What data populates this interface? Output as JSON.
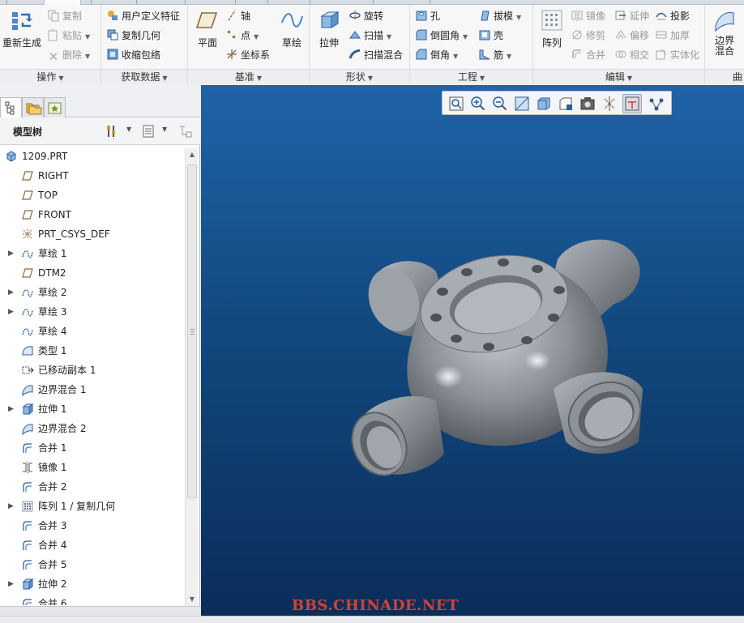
{
  "ribbon": {
    "groups": {
      "operations": "操作",
      "get_data": "获取数据",
      "datum": "基准",
      "shapes": "形状",
      "engineering": "工程",
      "editing": "编辑"
    },
    "operations": {
      "regenerate": "重新生成",
      "copy": "复制",
      "paste": "粘贴",
      "delete": "删除"
    },
    "get_data": {
      "user_defined_feature": "用户定义特征",
      "copy_geometry": "复制几何",
      "shrinkwrap": "收缩包络"
    },
    "datum": {
      "plane": "平面",
      "axis": "轴",
      "point": "点",
      "csys": "坐标系",
      "sketch": "草绘"
    },
    "shapes": {
      "extrude": "拉伸",
      "revolve": "旋转",
      "sweep": "扫描",
      "swept_blend": "扫描混合"
    },
    "engineering": {
      "hole": "孔",
      "round": "倒圆角",
      "chamfer": "倒角",
      "draft": "拔模",
      "shell": "壳",
      "rib": "筋"
    },
    "editing": {
      "pattern": "阵列",
      "mirror": "镜像",
      "trim": "修剪",
      "merge": "合并",
      "extend": "延伸",
      "offset": "偏移",
      "intersect": "相交",
      "project": "投影",
      "thicken": "加厚",
      "solidify": "实体化"
    },
    "surfaces": {
      "boundary_blend_line1": "边界",
      "boundary_blend_line2": "混合",
      "cut_label": "曲"
    }
  },
  "model_tree": {
    "title": "模型树",
    "items": [
      {
        "label": "1209.PRT",
        "icon": "part-icon",
        "expandable": false
      },
      {
        "label": "RIGHT",
        "icon": "datum-plane-icon",
        "expandable": false
      },
      {
        "label": "TOP",
        "icon": "datum-plane-icon",
        "expandable": false
      },
      {
        "label": "FRONT",
        "icon": "datum-plane-icon",
        "expandable": false
      },
      {
        "label": "PRT_CSYS_DEF",
        "icon": "csys-icon",
        "expandable": false
      },
      {
        "label": "草绘 1",
        "icon": "sketch-icon",
        "expandable": true
      },
      {
        "label": "DTM2",
        "icon": "datum-plane-icon",
        "expandable": false
      },
      {
        "label": "草绘 2",
        "icon": "sketch-icon",
        "expandable": true
      },
      {
        "label": "草绘 3",
        "icon": "sketch-icon",
        "expandable": true
      },
      {
        "label": "草绘 4",
        "icon": "sketch-icon",
        "expandable": false
      },
      {
        "label": "类型 1",
        "icon": "style-icon",
        "expandable": false
      },
      {
        "label": "已移动副本 1",
        "icon": "moved-copy-icon",
        "expandable": false
      },
      {
        "label": "边界混合 1",
        "icon": "boundary-blend-icon",
        "expandable": false
      },
      {
        "label": "拉伸 1",
        "icon": "extrude-icon",
        "expandable": true
      },
      {
        "label": "边界混合 2",
        "icon": "boundary-blend-icon",
        "expandable": false
      },
      {
        "label": "合并 1",
        "icon": "merge-icon",
        "expandable": false
      },
      {
        "label": "镜像 1",
        "icon": "mirror-icon",
        "expandable": false
      },
      {
        "label": "合并 2",
        "icon": "merge-icon",
        "expandable": false
      },
      {
        "label": "阵列 1 / 复制几何",
        "icon": "pattern-icon",
        "expandable": true
      },
      {
        "label": "合并 3",
        "icon": "merge-icon",
        "expandable": false
      },
      {
        "label": "合并 4",
        "icon": "merge-icon",
        "expandable": false
      },
      {
        "label": "合并 5",
        "icon": "merge-icon",
        "expandable": false
      },
      {
        "label": "拉伸 2",
        "icon": "extrude-icon",
        "expandable": true
      },
      {
        "label": "合并 6",
        "icon": "merge-icon",
        "expandable": false
      }
    ]
  },
  "viewport": {
    "watermark": "BBS.CHINADE.NET"
  },
  "colors": {
    "accent": "#1f64a8",
    "viewport_top": "#1f64a8",
    "viewport_bottom": "#0a2d5a",
    "model": "#8a8f97",
    "watermark": "#c8453c"
  }
}
